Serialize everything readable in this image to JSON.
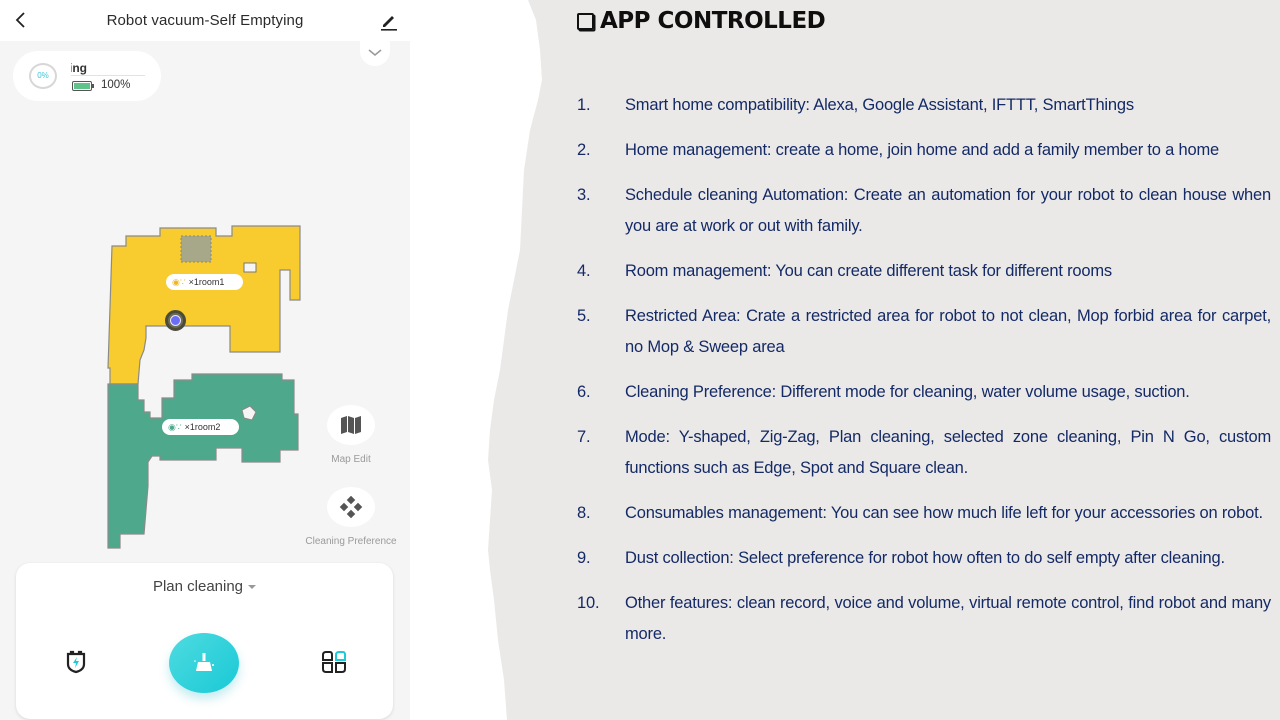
{
  "phone": {
    "header": {
      "back_icon": "chevron-left-icon",
      "title": "Robot vacuum-Self Emptying",
      "edit_icon": "pencil-icon"
    },
    "collapse_icon": "chevron-down-icon",
    "status": {
      "progress_label": "0%",
      "state_text": "Charging",
      "battery_percent": 100,
      "battery_label": "100%",
      "battery_color": "#5fc48a"
    },
    "map": {
      "rooms": [
        {
          "name": "room1",
          "tag": "×1room1",
          "color": "#f8cb2e",
          "icons": "mop+fan"
        },
        {
          "name": "room2",
          "tag": "×1room2",
          "color": "#4ea88c",
          "icons": "mop+fan"
        }
      ],
      "robot_marker_color": "#6c6df4"
    },
    "side_actions": [
      {
        "label": "Map Edit",
        "icon": "map-icon"
      },
      {
        "label": "Cleaning Preference",
        "icon": "preference-icon"
      }
    ],
    "control": {
      "mode_label": "Plan cleaning",
      "charge_icon": "charge-dock-icon",
      "clean_icon": "broom-icon",
      "rooms_icon": "room-grid-icon",
      "accent_color": "#1fcad6"
    }
  },
  "slide": {
    "title": "APP CONTROLLED",
    "title_icon": "checkbox-icon",
    "features": [
      {
        "num": "1.",
        "text": "Smart home compatibility:  Alexa, Google Assistant, IFTTT, SmartThings"
      },
      {
        "num": "2.",
        "text": "Home management: create a home, join home and add a family member to a home"
      },
      {
        "num": "3.",
        "text": "Schedule cleaning Automation:  Create an automation for your robot to clean house when you are at work or out with family."
      },
      {
        "num": "4.",
        "text": "Room management: You can create different task for different rooms"
      },
      {
        "num": "5.",
        "text": "Restricted Area: Crate a restricted area for robot to not clean,  Mop forbid area for carpet, no Mop & Sweep area"
      },
      {
        "num": "6.",
        "text": "Cleaning Preference: Different mode for cleaning, water volume usage, suction."
      },
      {
        "num": "7.",
        "text": "Mode: Y-shaped, Zig-Zag, Plan cleaning, selected zone cleaning, Pin N Go, custom functions such  as Edge, Spot and Square clean."
      },
      {
        "num": "8.",
        "text": "Consumables management: You can see how much life left for your accessories on robot."
      },
      {
        "num": "9.",
        "text": "Dust collection: Select preference for robot how often to do self empty after cleaning."
      },
      {
        "num": "10.",
        "text": "Other features: clean record, voice and volume, virtual remote control, find robot and many more."
      }
    ],
    "text_color": "#142a66",
    "background_color": "#ebe9e8"
  }
}
